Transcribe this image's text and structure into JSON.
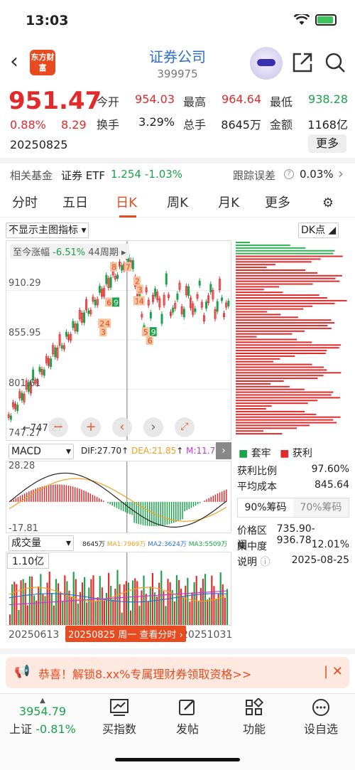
{
  "status": {
    "time": "13:03"
  },
  "header": {
    "title": "证券公司",
    "code": "399975",
    "logo_text": "东方财富"
  },
  "quote": {
    "price": "951.47",
    "pct": "0.88%",
    "change": "8.29",
    "date": "20250825",
    "open_label": "今开",
    "open": "954.03",
    "high_label": "最高",
    "high": "964.64",
    "low_label": "最低",
    "low": "938.28",
    "turnover_label": "换手",
    "turnover": "3.29%",
    "volume_label": "总手",
    "volume": "8645万",
    "amount_label": "金额",
    "amount": "1168亿",
    "more_label": "更多"
  },
  "fund": {
    "label": "相关基金",
    "name": "证券 ETF",
    "price": "1.254",
    "pct": "-1.03%",
    "track_label": "跟踪误差",
    "track_value": "0.03%"
  },
  "tabs": [
    "分时",
    "五日",
    "日K",
    "周K",
    "月K",
    "更多"
  ],
  "active_tab": "日K",
  "chart_controls": {
    "indicator_select": "不显示主图指标",
    "dk_select": "DK点",
    "range_label": "至今涨幅",
    "range_pct": "-6.51%",
    "range_period": "44周期"
  },
  "price_axis": [
    "910.29",
    "855.95",
    "801.61",
    "747.27"
  ],
  "low_marker": "747.27",
  "kline_badges": {
    "b1": "8",
    "b2": "7",
    "b3": "6",
    "b4": "9",
    "b5": "2",
    "b6": "3",
    "b7": "1",
    "b8": "4",
    "b9": "2",
    "b10": "4",
    "b11": "3",
    "b12": "5",
    "b13": "9",
    "b14": "6"
  },
  "macd": {
    "select": "MACD",
    "dif": "DIF:27.70",
    "dea": "DEA:21.85",
    "m": "M:11.7",
    "top": "28.28",
    "bottom": "-17.81"
  },
  "volume": {
    "select": "成交量",
    "label": "8645万",
    "ma1": "MA1:7969万",
    "ma2": "MA2:3624万",
    "ma3": "MA3:5509万",
    "axis": "1.10亿"
  },
  "dates": {
    "start": "20250613",
    "end": "20251031",
    "tooltip": "20250825 周一  查看分时"
  },
  "chips": {
    "legend_trapped": "套牢",
    "legend_profit": "获利",
    "rows": [
      {
        "label": "获利比例",
        "value": "97.60%"
      },
      {
        "label": "平均成本",
        "value": "845.64"
      }
    ],
    "tab90": "90%筹码",
    "tab70": "70%筹码",
    "rows2": [
      {
        "label": "价格区间",
        "value": "735.90-936.78"
      },
      {
        "label": "集中度",
        "value": "12.01%"
      },
      {
        "label": "说明",
        "value": "2025-08-25"
      }
    ]
  },
  "banner": {
    "text": "恭喜！解锁8.xx%专属理财券领取资格>>"
  },
  "bottom_nav": {
    "index_value": "3954.79",
    "index_name": "上证",
    "index_pct": "-0.81%",
    "items": [
      "买指数",
      "发帖",
      "功能",
      "设自选"
    ]
  },
  "colors": {
    "up": "#e22a2a",
    "down": "#1aa34a",
    "accent": "#e84b1f",
    "link": "#2c6fd1"
  }
}
